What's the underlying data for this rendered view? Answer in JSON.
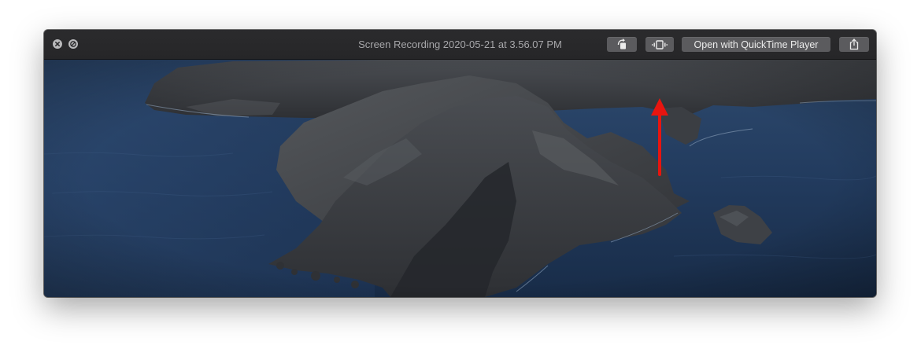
{
  "window": {
    "title": "Screen Recording 2020-05-21 at 3.56.07 PM"
  },
  "toolbar": {
    "rotate_icon": "rotate-left-icon",
    "trim_icon": "trim-icon",
    "open_quicktime_label": "Open with QuickTime Player",
    "share_icon": "share-icon"
  },
  "annotation": {
    "arrow_color": "#e8150f"
  }
}
